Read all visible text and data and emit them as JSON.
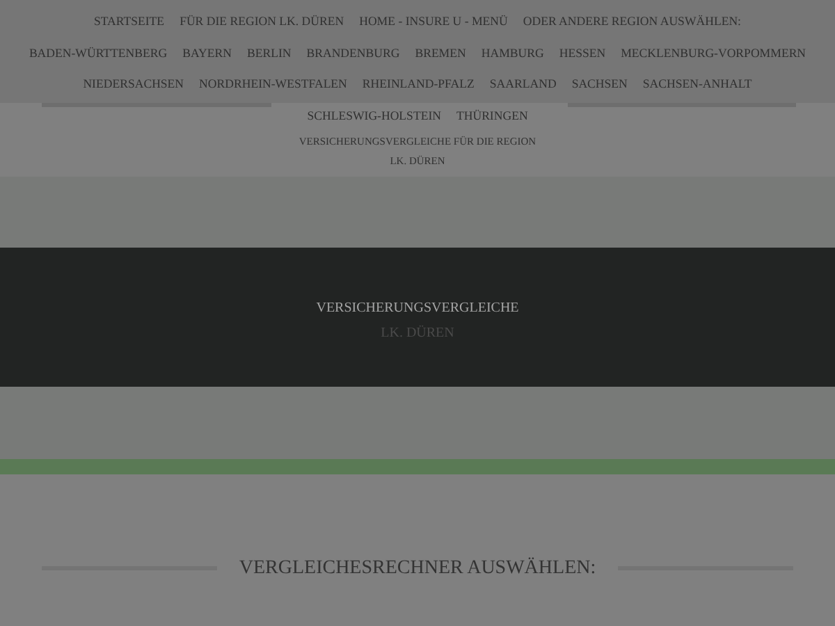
{
  "menu": [
    [
      "STARTSEITE",
      "FÜR DIE REGION LK. DÜREN",
      "HOME - INSURE U - MENÜ",
      "ODER ANDERE REGION AUSWÄHLEN:"
    ],
    [
      "BADEN-WÜRTTENBERG",
      "BAYERN",
      "BERLIN",
      "BRANDENBURG",
      "BREMEN",
      "HAMBURG",
      "HESSEN",
      "MECKLENBURG-VORPOMMERN"
    ],
    [
      "NIEDERSACHSEN",
      "NORDRHEIN-WESTFALEN",
      "RHEINLAND-PFALZ",
      "SAARLAND",
      "SACHSEN",
      "SACHSEN-ANHALT"
    ],
    [
      "SCHLESWIG-HOLSTEIN",
      "THÜRINGEN"
    ]
  ],
  "tagline": [
    "VERSICHERUNGSVERGLEICHE FÜR DIE REGION",
    "LK. DÜREN"
  ],
  "banner": {
    "title": "VERSICHERUNGSVERGLEICHE",
    "subtitle": "LK. DÜREN"
  },
  "section_heading": "VERGLEICHESRECHNER AUSWÄHLEN:"
}
